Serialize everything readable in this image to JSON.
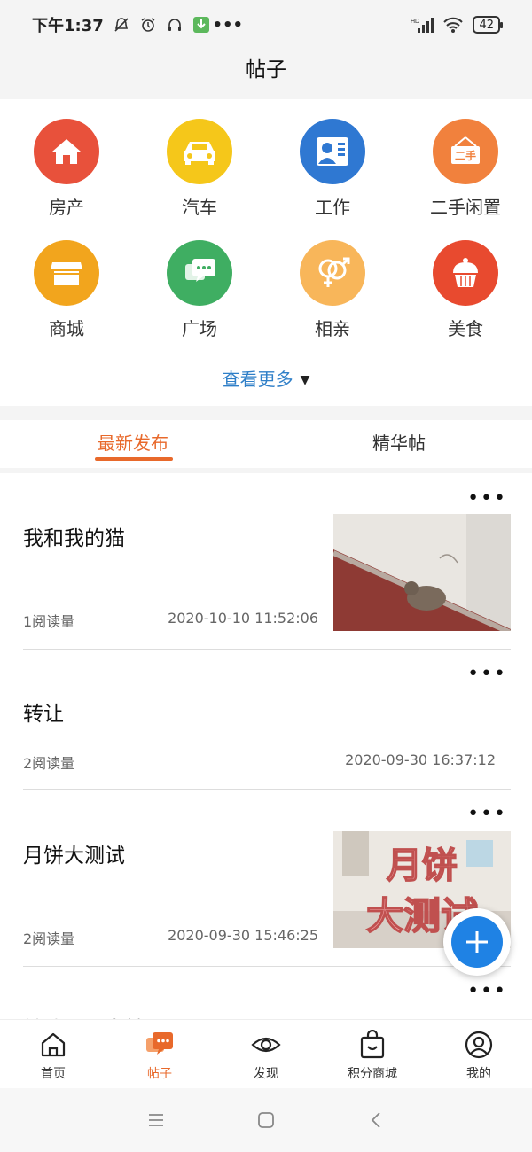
{
  "status": {
    "time": "下午1:37",
    "icons": [
      "mute-icon",
      "alarm-icon",
      "headphones-icon",
      "download-icon",
      "more-dots-icon"
    ],
    "right_icons": [
      "hd-signal-icon",
      "wifi-icon"
    ],
    "battery": "42"
  },
  "header": {
    "title": "帖子"
  },
  "categories": [
    {
      "label": "房产",
      "icon": "house-icon",
      "color": "#e8513b"
    },
    {
      "label": "汽车",
      "icon": "car-icon",
      "color": "#f5c71a"
    },
    {
      "label": "工作",
      "icon": "id-card-icon",
      "color": "#2f78d2"
    },
    {
      "label": "二手闲置",
      "icon": "secondhand-sign-icon",
      "color": "#f1813d"
    },
    {
      "label": "商城",
      "icon": "store-icon",
      "color": "#f2a51d"
    },
    {
      "label": "广场",
      "icon": "chat-bubbles-icon",
      "color": "#3fae62"
    },
    {
      "label": "相亲",
      "icon": "gender-symbols-icon",
      "color": "#f8b65a"
    },
    {
      "label": "美食",
      "icon": "cupcake-icon",
      "color": "#e84a2f"
    }
  ],
  "more": {
    "label": "查看更多"
  },
  "tabs": [
    {
      "label": "最新发布",
      "active": true
    },
    {
      "label": "精华帖",
      "active": false
    }
  ],
  "posts": [
    {
      "title": "我和我的猫",
      "reads": "1阅读量",
      "date": "2020-10-10 11:52:06",
      "thumb": "cat photo"
    },
    {
      "title": "转让",
      "reads": "2阅读量",
      "date": "2020-09-30 16:37:12",
      "thumb": ""
    },
    {
      "title": "月饼大测试",
      "reads": "2阅读量",
      "date": "2020-09-30 15:46:25",
      "thumb": "月饼 大测试"
    },
    {
      "title": "转让员工桌椅",
      "reads": "",
      "date": "",
      "thumb": ""
    }
  ],
  "thumb_text": {
    "line1": "月饼",
    "line2": "大测试"
  },
  "bottom_nav": [
    {
      "label": "首页",
      "icon": "home-icon",
      "active": false
    },
    {
      "label": "帖子",
      "icon": "posts-chat-icon",
      "active": true
    },
    {
      "label": "发现",
      "icon": "eye-icon",
      "active": false
    },
    {
      "label": "积分商城",
      "icon": "shopping-bag-icon",
      "active": false
    },
    {
      "label": "我的",
      "icon": "user-icon",
      "active": false
    }
  ],
  "colors": {
    "accent": "#e8692b",
    "link": "#2f7fc8",
    "fab": "#1f82e4"
  }
}
